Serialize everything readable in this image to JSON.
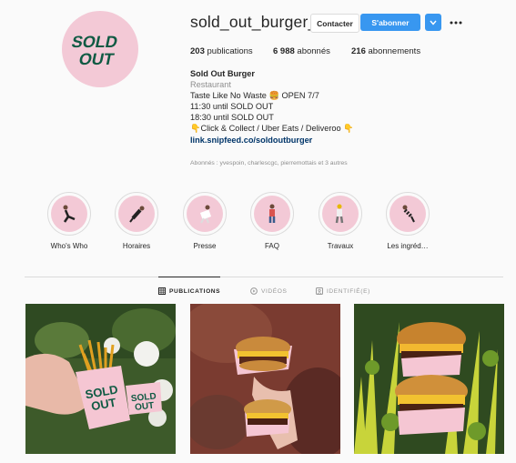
{
  "profile": {
    "username": "sold_out_burger_",
    "logo_text_line1": "SOLD",
    "logo_text_line2": "OUT",
    "contact_label": "Contacter",
    "follow_label": "S'abonner"
  },
  "stats": {
    "posts_count": "203",
    "posts_label": "publications",
    "followers_count": "6 988",
    "followers_label": "abonnés",
    "following_count": "216",
    "following_label": "abonnements"
  },
  "bio": {
    "name": "Sold Out Burger",
    "category": "Restaurant",
    "line1": "Taste Like No Waste 🍔 OPEN 7/7",
    "line2": "11:30 until SOLD OUT",
    "line3": "18:30 until SOLD OUT",
    "line4": "👇Click & Collect / Uber Eats / Deliveroo 👇",
    "link": "link.snipfeed.co/soldoutburger",
    "followed_by": "Abonnés : yvespoin, charlescgc, pierremottais et 3 autres"
  },
  "highlights": [
    {
      "label": "Who's Who"
    },
    {
      "label": "Horaires"
    },
    {
      "label": "Presse"
    },
    {
      "label": "FAQ"
    },
    {
      "label": "Travaux"
    },
    {
      "label": "Les ingréd…"
    }
  ],
  "tabs": {
    "publications": "PUBLICATIONS",
    "videos": "VIDÉOS",
    "tagged": "IDENTIFIÉ(E)"
  },
  "colors": {
    "brand_pink": "#f3c9d6",
    "brand_green": "#0f5a43",
    "follow_blue": "#3897f0",
    "link_blue": "#003569"
  },
  "icons": [
    "more-options-icon",
    "chevron-down-icon",
    "grid-icon",
    "video-icon",
    "tagged-icon"
  ]
}
